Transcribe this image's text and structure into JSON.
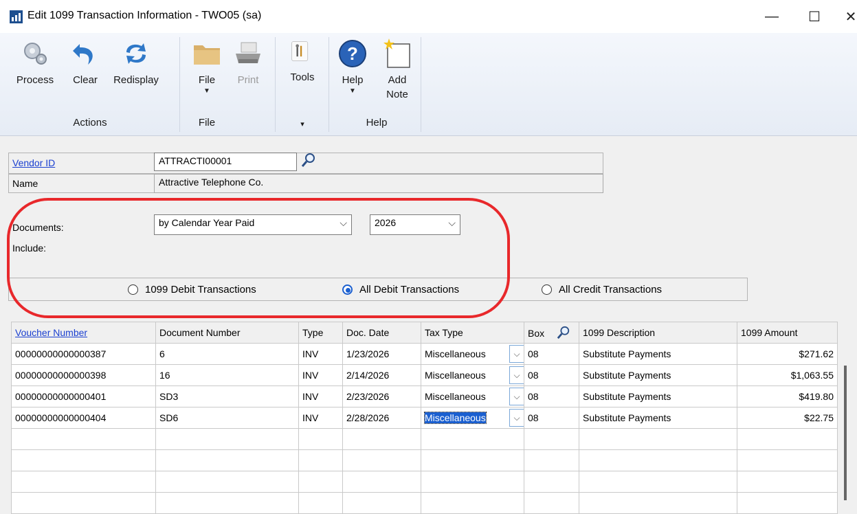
{
  "window": {
    "title": "Edit 1099 Transaction Information  -  TWO05 (sa)",
    "min_icon": "minimize-icon",
    "max_icon": "maximize-icon",
    "close_icon": "close-icon"
  },
  "ribbon": {
    "groups": [
      {
        "label": "Actions"
      },
      {
        "label": "File"
      },
      {
        "label": ""
      },
      {
        "label": "Help"
      }
    ],
    "tools_group_caret": "▾",
    "buttons": {
      "process": "Process",
      "clear": "Clear",
      "redisplay": "Redisplay",
      "file": "File",
      "print": "Print",
      "tools": "Tools",
      "help": "Help",
      "add_note_line1": "Add",
      "add_note_line2": "Note"
    }
  },
  "form": {
    "vendor_id_label": "Vendor ID",
    "vendor_id_value": "ATTRACTI00001",
    "name_label": "Name",
    "name_value": "Attractive Telephone Co.",
    "documents_label": "Documents:",
    "documents_value": "by Calendar Year Paid",
    "year_value": "2026",
    "include_label": "Include:",
    "radios": [
      {
        "label": "1099 Debit Transactions",
        "selected": false
      },
      {
        "label": "All Debit Transactions",
        "selected": true
      },
      {
        "label": "All Credit Transactions",
        "selected": false
      }
    ]
  },
  "grid": {
    "headers": [
      "Voucher Number",
      "Document Number",
      "Type",
      "Doc. Date",
      "Tax Type",
      "Box",
      "1099 Description",
      "1099 Amount"
    ],
    "rows": [
      {
        "voucher": "00000000000000387",
        "doc": "6",
        "type": "INV",
        "date": "1/23/2026",
        "tax": "Miscellaneous",
        "box": "08",
        "desc": "Substitute Payments",
        "amount": "$271.62"
      },
      {
        "voucher": "00000000000000398",
        "doc": "16",
        "type": "INV",
        "date": "2/14/2026",
        "tax": "Miscellaneous",
        "box": "08",
        "desc": "Substitute Payments",
        "amount": "$1,063.55"
      },
      {
        "voucher": "00000000000000401",
        "doc": "SD3",
        "type": "INV",
        "date": "2/23/2026",
        "tax": "Miscellaneous",
        "box": "08",
        "desc": "Substitute Payments",
        "amount": "$419.80"
      },
      {
        "voucher": "00000000000000404",
        "doc": "SD6",
        "type": "INV",
        "date": "2/28/2026",
        "tax": "Miscellaneous",
        "box": "08",
        "desc": "Substitute Payments",
        "amount": "$22.75"
      }
    ]
  },
  "colors": {
    "link": "#1a3fd0",
    "highlight": "#1a5fd0",
    "annotation_red": "#e8282b"
  }
}
